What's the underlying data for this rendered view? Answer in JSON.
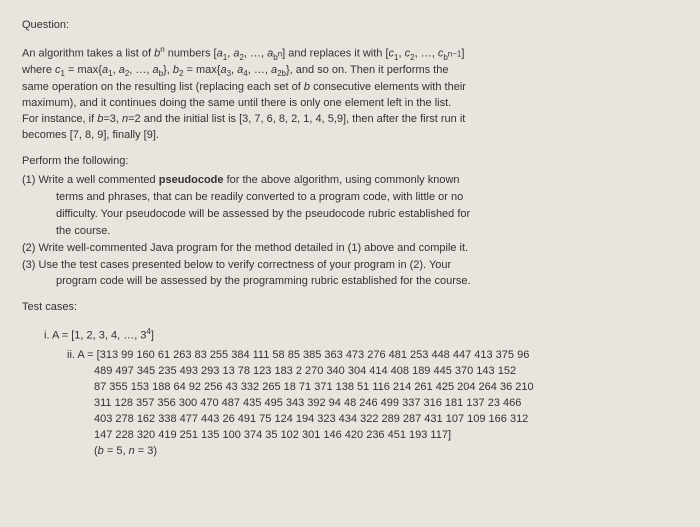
{
  "heading": "Question:",
  "intro": {
    "p1a": "An algorithm takes a list of ",
    "p1b": " numbers [",
    "p1c": "] and replaces it with [",
    "p1d": "]",
    "p2a": "where ",
    "p2b": " = max{",
    "p2c": "}, ",
    "p2d": " = max{",
    "p2e": "}, and so on. Then it performs the",
    "p3": "same operation on the resulting list (replacing each set of ",
    "p3b": " consecutive elements with their",
    "p4": "maximum), and it continues doing the same until there is only one element left in the list.",
    "p5": "For instance, if ",
    "p5b": "=3, ",
    "p5c": "=2 and the initial list is [3, 7, 6, 8, 2, 1, 4, 5,9], then after the first run it",
    "p6": "becomes [7, 8, 9], finally [9].",
    "bn": "b",
    "bn_sup": "n",
    "a1": "a",
    "a1s": "1",
    "a2": "a",
    "a2s": "2",
    "abn": "a",
    "abn_s": "b",
    "abn_sup": "n",
    "c1": "c",
    "c1s": "1",
    "c2": "c",
    "c2s": "2",
    "cbn": "c",
    "cbn_s": "b",
    "cbn_sup": "n−1",
    "ab": "a",
    "ab_s": "b",
    "b2": "b",
    "b2s": "2",
    "a3": "a",
    "a3s": "3",
    "a4": "a",
    "a4s": "4",
    "a2b": "a",
    "a2b_s": "2b",
    "b_var": "b",
    "n_var": "n",
    "dots": ", …, "
  },
  "perform": "Perform the following:",
  "tasks": {
    "t1a": "(1) Write a well commented ",
    "t1_bold": "pseudocode",
    "t1b": " for the above algorithm, using commonly known",
    "t1_line2": "terms and phrases, that can be readily converted to a program code, with little or no",
    "t1_line3": "difficulty. Your pseudocode will be assessed by the pseudocode rubric established for",
    "t1_line4": "the course.",
    "t2": "(2) Write well-commented Java program for the method detailed in (1) above and compile it.",
    "t3a": "(3) Use the test cases presented below to verify correctness of your program in (2). Your",
    "t3_line2": "program code will be assessed by the programming rubric established for the course."
  },
  "test_heading": "Test cases:",
  "tc": {
    "i_a": "i. A = [1, 2, 3, 4, …, 3",
    "i_sup": "4",
    "i_b": "]",
    "ii_l1": "ii. A = [313 99 160 61 263 83 255 384 111 58 85 385 363 473 276 481 253 448 447 413 375 96",
    "ii_l2": "489 497 345 235 493 293 13 78 123 183 2 270 340 304 414 408 189 445 370 143 152",
    "ii_l3": "87 355 153 188 64 92 256 43 332 265 18 71 371 138 51 116 214 261 425 204 264 36 210",
    "ii_l4": "311 128 357 356 300 470 487 435 495 343 392 94 48 246 499 337 316 181 137 23 466",
    "ii_l5": "403 278 162 338 477 443 26 491 75 124 194 323 434 322 289 287 431 107 109 166 312",
    "ii_l6": "147 228 320 419 251 135 100 374 35 102 301 146 420 236 451 193 117]",
    "ii_bn": "(b = 5, n = 3)"
  }
}
